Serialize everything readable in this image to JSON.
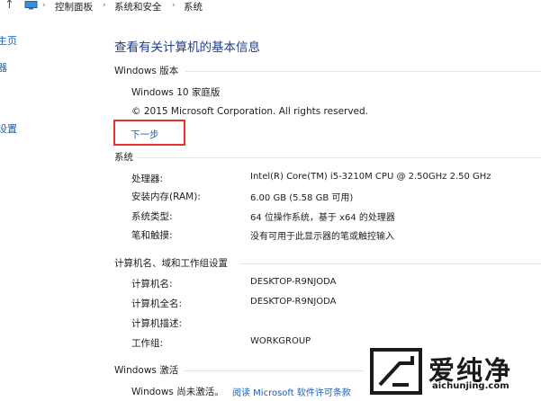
{
  "breadcrumb": {
    "items": [
      "控制面板",
      "系统和安全",
      "系统"
    ]
  },
  "leftnav": {
    "items": [
      "主页",
      "器",
      "设置"
    ]
  },
  "page": {
    "title": "查看有关计算机的基本信息"
  },
  "windows_edition": {
    "heading": "Windows 版本",
    "edition": "Windows 10 家庭版",
    "copyright": "© 2015 Microsoft Corporation. All rights reserved.",
    "next_link": "下一步"
  },
  "system": {
    "heading": "系统",
    "rows": [
      {
        "label": "处理器:",
        "value": "Intel(R) Core(TM) i5-3210M CPU @ 2.50GHz   2.50 GHz"
      },
      {
        "label": "安装内存(RAM):",
        "value": "6.00 GB (5.58 GB 可用)"
      },
      {
        "label": "系统类型:",
        "value": "64 位操作系统，基于 x64 的处理器"
      },
      {
        "label": "笔和触摸:",
        "value": "没有可用于此显示器的笔或触控输入"
      }
    ]
  },
  "computer_name": {
    "heading": "计算机名、域和工作组设置",
    "rows": [
      {
        "label": "计算机名:",
        "value": "DESKTOP-R9NJODA"
      },
      {
        "label": "计算机全名:",
        "value": "DESKTOP-R9NJODA"
      },
      {
        "label": "计算机描述:",
        "value": ""
      },
      {
        "label": "工作组:",
        "value": "WORKGROUP"
      }
    ]
  },
  "activation": {
    "heading": "Windows 激活",
    "status": "Windows 尚未激活。",
    "link": "阅读 Microsoft 软件许可条款"
  },
  "watermark": {
    "brand": "爱纯净",
    "url": "aichunjing.com"
  },
  "colors": {
    "title": "#1e3f8a",
    "link": "#1a5fb4",
    "highlight_box": "#e8322d"
  }
}
